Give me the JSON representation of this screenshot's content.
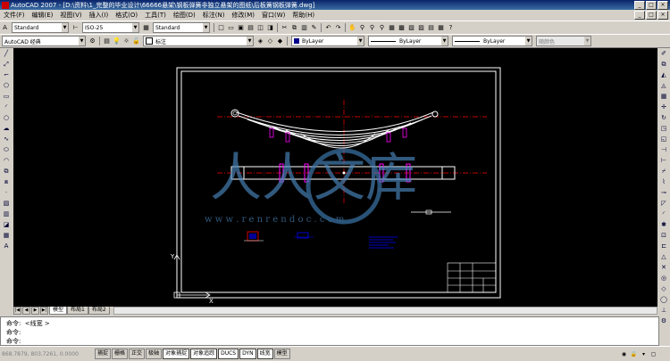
{
  "window": {
    "title": "AutoCAD 2007 - [D:\\资料\\1_完整的毕业设计\\66666悬架\\钢板弹簧非独立悬架的图纸\\后板簧钢板弹簧.dwg]",
    "minimize": "_",
    "maximize": "□",
    "close": "×"
  },
  "menu": {
    "items": [
      "文件(F)",
      "编辑(E)",
      "视图(V)",
      "插入(I)",
      "格式(O)",
      "工具(T)",
      "绘图(D)",
      "标注(N)",
      "修改(M)",
      "窗口(W)",
      "帮助(H)"
    ],
    "doc_min": "_",
    "doc_restore": "□",
    "doc_close": "×"
  },
  "toolbar1": {
    "text_style": "Standard",
    "dim_style": "ISO-25",
    "table_style": "Standard"
  },
  "toolbar2": {
    "workspace": "AutoCAD 经典",
    "layer_name": "标注",
    "color": "ByLayer",
    "linetype": "ByLayer",
    "lineweight": "ByLayer",
    "plotstyle": "随颜色"
  },
  "layout_tabs": {
    "tabs": [
      "模型",
      "布局1",
      "布局2"
    ],
    "active": "模型"
  },
  "command": {
    "line1": "命令:  <线宽 >",
    "line2": "命令:",
    "line3": "命令:"
  },
  "status": {
    "coords": "868.7879, 803.7261, 0.0000",
    "buttons": [
      "捕捉",
      "栅格",
      "正交",
      "极轴",
      "对象捕捉",
      "对象追踪",
      "DUCS",
      "DYN",
      "线宽",
      "模型"
    ],
    "active_buttons": [
      "对象捕捉",
      "对象追踪",
      "DUCS",
      "DYN",
      "线宽"
    ]
  },
  "watermark": {
    "text": "人人文库",
    "url": "w w w . r e n r e n d o c . c o m"
  },
  "drawing": {
    "ucs_y": "Y",
    "ucs_x": "X"
  },
  "colors": {
    "canvas": "#000000",
    "spring": "#ffffff",
    "centerline": "#ff0000",
    "dimension": "#0000ff",
    "frame": "#ffffff"
  }
}
